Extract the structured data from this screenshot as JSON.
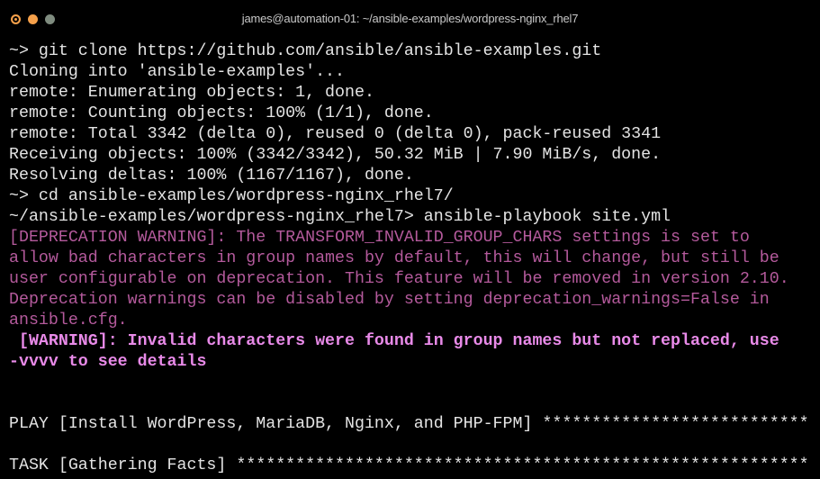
{
  "window": {
    "title": "james@automation-01: ~/ansible-examples/wordpress-nginx_rhel7",
    "buttons": {
      "close_color": "#f5a04a",
      "minimize_color": "#f5a04a",
      "zoom_color": "#7f8c7f"
    }
  },
  "terminal": {
    "lines": [
      {
        "text": "~> git clone https://github.com/ansible/ansible-examples.git",
        "style": "normal"
      },
      {
        "text": "Cloning into 'ansible-examples'...",
        "style": "normal"
      },
      {
        "text": "remote: Enumerating objects: 1, done.",
        "style": "normal"
      },
      {
        "text": "remote: Counting objects: 100% (1/1), done.",
        "style": "normal"
      },
      {
        "text": "remote: Total 3342 (delta 0), reused 0 (delta 0), pack-reused 3341",
        "style": "normal"
      },
      {
        "text": "Receiving objects: 100% (3342/3342), 50.32 MiB | 7.90 MiB/s, done.",
        "style": "normal"
      },
      {
        "text": "Resolving deltas: 100% (1167/1167), done.",
        "style": "normal"
      },
      {
        "text": "~> cd ansible-examples/wordpress-nginx_rhel7/",
        "style": "normal"
      },
      {
        "text": "~/ansible-examples/wordpress-nginx_rhel7> ansible-playbook site.yml",
        "style": "normal"
      },
      {
        "text": "[DEPRECATION WARNING]: The TRANSFORM_INVALID_GROUP_CHARS settings is set to",
        "style": "dep"
      },
      {
        "text": "allow bad characters in group names by default, this will change, but still be",
        "style": "dep"
      },
      {
        "text": "user configurable on deprecation. This feature will be removed in version 2.10.",
        "style": "dep"
      },
      {
        "text": "Deprecation warnings can be disabled by setting deprecation_warnings=False in",
        "style": "dep"
      },
      {
        "text": "ansible.cfg.",
        "style": "dep"
      },
      {
        "text": " [WARNING]: Invalid characters were found in group names but not replaced, use",
        "style": "warn"
      },
      {
        "text": "-vvvv to see details",
        "style": "warn"
      },
      {
        "text": "",
        "style": "normal"
      },
      {
        "text": "",
        "style": "normal"
      },
      {
        "text": "PLAY [Install WordPress, MariaDB, Nginx, and PHP-FPM] ***************************",
        "style": "normal"
      },
      {
        "text": "",
        "style": "normal"
      },
      {
        "text": "TASK [Gathering Facts] **********************************************************",
        "style": "normal"
      }
    ]
  }
}
